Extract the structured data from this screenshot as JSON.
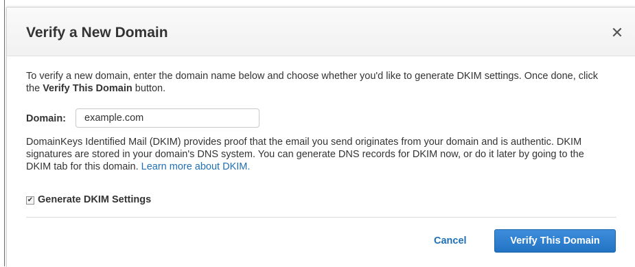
{
  "dialog": {
    "title": "Verify a New Domain",
    "close_glyph": "✕"
  },
  "intro": {
    "text_before": "To verify a new domain, enter the domain name below and choose whether you'd like to generate DKIM settings. Once done, click the ",
    "bold_text": "Verify This Domain",
    "text_after": " button."
  },
  "domain_field": {
    "label": "Domain:",
    "value": "example.com"
  },
  "dkim": {
    "description": "DomainKeys Identified Mail (DKIM) provides proof that the email you send originates from your domain and is authentic. DKIM signatures are stored in your domain's DNS system. You can generate DNS records for DKIM now, or do it later by going to the DKIM tab for this domain. ",
    "learn_more_link": "Learn more about DKIM.",
    "checkbox_label": "Generate DKIM Settings",
    "checkbox_checked": true,
    "checkbox_glyph": "✔"
  },
  "footer": {
    "cancel_label": "Cancel",
    "verify_label": "Verify This Domain"
  },
  "colors": {
    "accent_blue": "#2273c3",
    "link_blue": "#1f6fb5",
    "text": "#333333"
  }
}
